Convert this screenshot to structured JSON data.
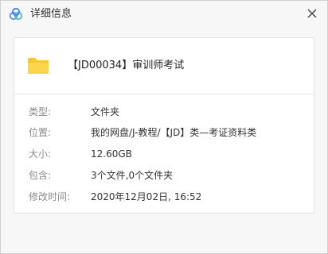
{
  "window": {
    "title": "详细信息",
    "app_icon": "share-link-icon",
    "close_icon": "close-icon"
  },
  "file": {
    "icon": "folder-icon",
    "name": "【JD00034】审训师考试"
  },
  "properties": [
    {
      "label": "类型:",
      "value": "文件夹"
    },
    {
      "label": "位置:",
      "value": "我的网盘/J-教程/【JD】类—考证资料类"
    },
    {
      "label": "大小:",
      "value": "12.60GB"
    },
    {
      "label": "包含:",
      "value": "3个文件,0个文件夹"
    },
    {
      "label": "修改时间:",
      "value": "2020年12月02日, 16:52"
    }
  ],
  "colors": {
    "accent": "#4a7ff0",
    "folder": "#f7c82f"
  }
}
